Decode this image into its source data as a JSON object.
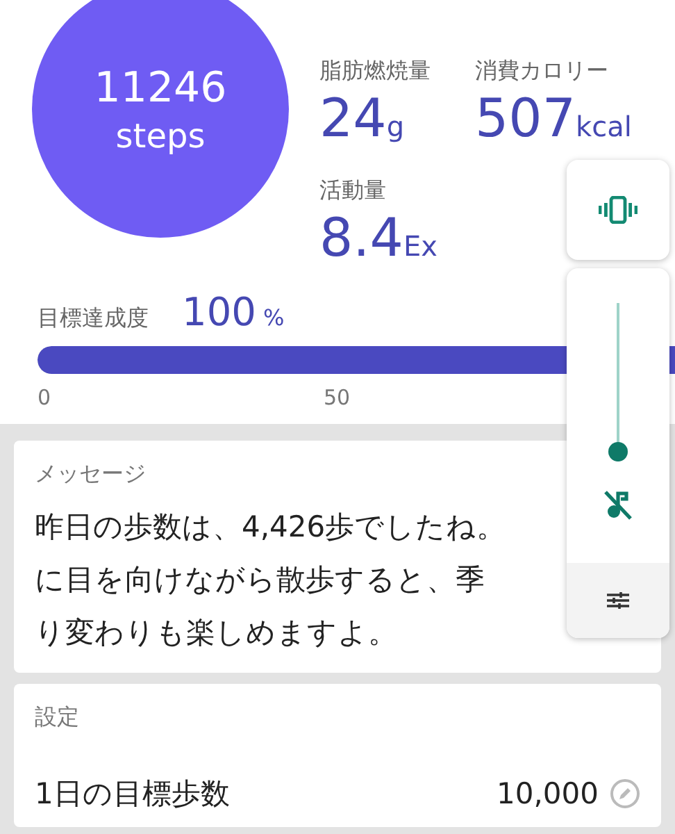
{
  "steps": {
    "count": "11246",
    "unit": "steps"
  },
  "stats": [
    {
      "label": "脂肪燃焼量",
      "value": "24",
      "unit": "g"
    },
    {
      "label": "消費カロリー",
      "value": "507",
      "unit": "kcal"
    },
    {
      "label": "活動量",
      "value": "8.4",
      "unit": "Ex"
    }
  ],
  "goal": {
    "label": "目標達成度",
    "value": "100",
    "unit": "%",
    "level": 1,
    "ticks": [
      "0",
      "50"
    ]
  },
  "message": {
    "title": "メッセージ",
    "lines": [
      "昨日の歩数は、4,426歩でしたね。",
      "に目を向けながら散歩すると、季",
      "り変わりも楽しめますよ。"
    ]
  },
  "settings": {
    "title": "設定",
    "rows": [
      {
        "label": "1日の目標歩数",
        "value": "10,000"
      }
    ]
  },
  "volume_panel": {
    "level": 0,
    "muted": true
  }
}
